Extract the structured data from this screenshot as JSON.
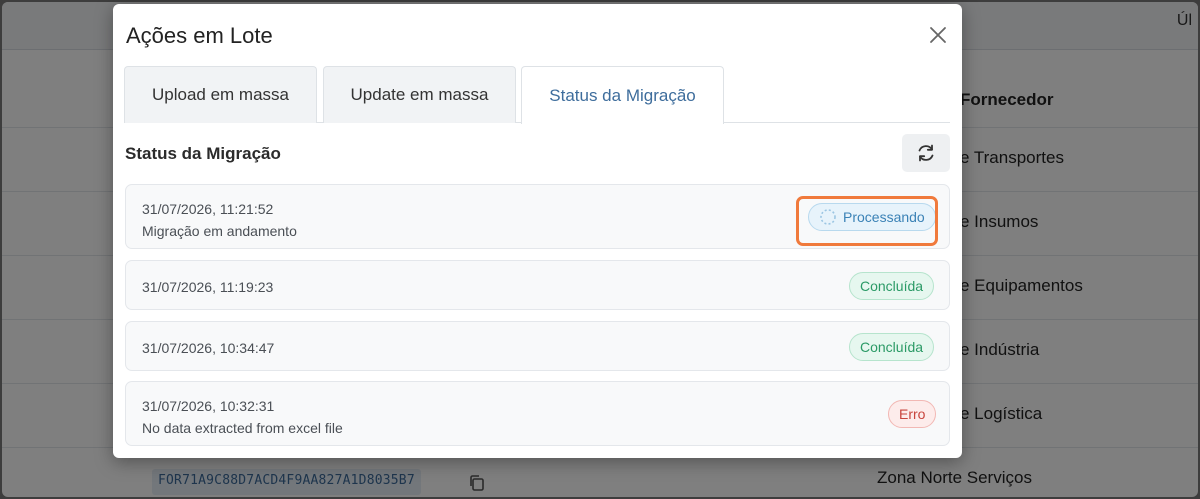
{
  "background": {
    "header_right_text": "Úl",
    "column_header": "Fornecedor",
    "rows": [
      "e Transportes",
      "e Insumos",
      "e Equipamentos",
      "e Indústria",
      "e Logística",
      "Zona Norte Serviços"
    ],
    "code": "FOR71A9C88D7ACD4F9AA827A1D8035B7"
  },
  "modal": {
    "title": "Ações em Lote",
    "tabs": [
      {
        "label": "Upload em massa",
        "active": false
      },
      {
        "label": "Update em massa",
        "active": false
      },
      {
        "label": "Status da Migração",
        "active": true
      }
    ],
    "section_title": "Status da Migração",
    "items": [
      {
        "timestamp": "31/07/2026, 11:21:52",
        "message": "Migração em andamento",
        "status": "Processando",
        "status_type": "processing"
      },
      {
        "timestamp": "31/07/2026, 11:19:23",
        "message": "",
        "status": "Concluída",
        "status_type": "done"
      },
      {
        "timestamp": "31/07/2026, 10:34:47",
        "message": "",
        "status": "Concluída",
        "status_type": "done"
      },
      {
        "timestamp": "31/07/2026, 10:32:31",
        "message": "No data extracted from excel file",
        "status": "Erro",
        "status_type": "error"
      }
    ]
  },
  "colors": {
    "accent": "#3e6d9c",
    "processing": "#3b82b6",
    "done": "#2b9a66",
    "error": "#c8453d",
    "highlight": "#f07a3c"
  }
}
